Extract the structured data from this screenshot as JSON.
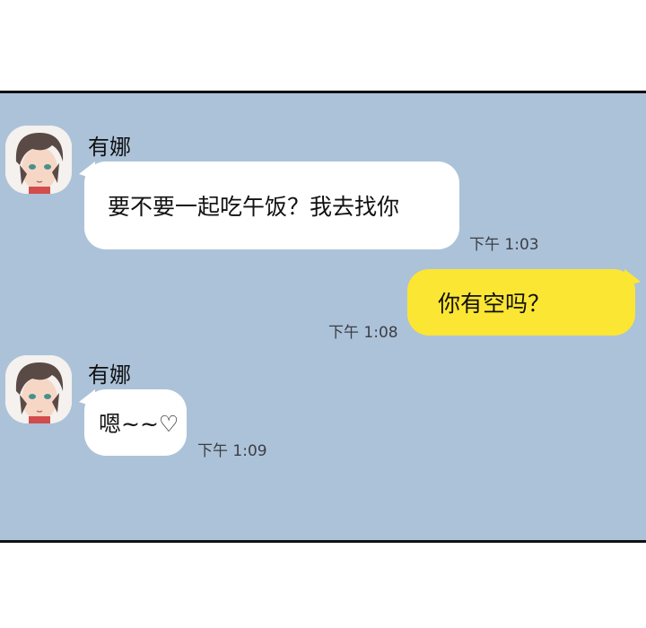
{
  "messages": [
    {
      "sender": "有娜",
      "text": "要不要一起吃午饭？我去找你",
      "time": "下午 1:03"
    },
    {
      "sender": "me",
      "text": "你有空吗？",
      "time": "下午 1:08"
    },
    {
      "sender": "有娜",
      "text": "嗯~~♡",
      "time": "下午 1:09"
    }
  ],
  "colors": {
    "chat_background": "#acc2d9",
    "incoming_bubble": "#ffffff",
    "outgoing_bubble": "#fce634"
  }
}
